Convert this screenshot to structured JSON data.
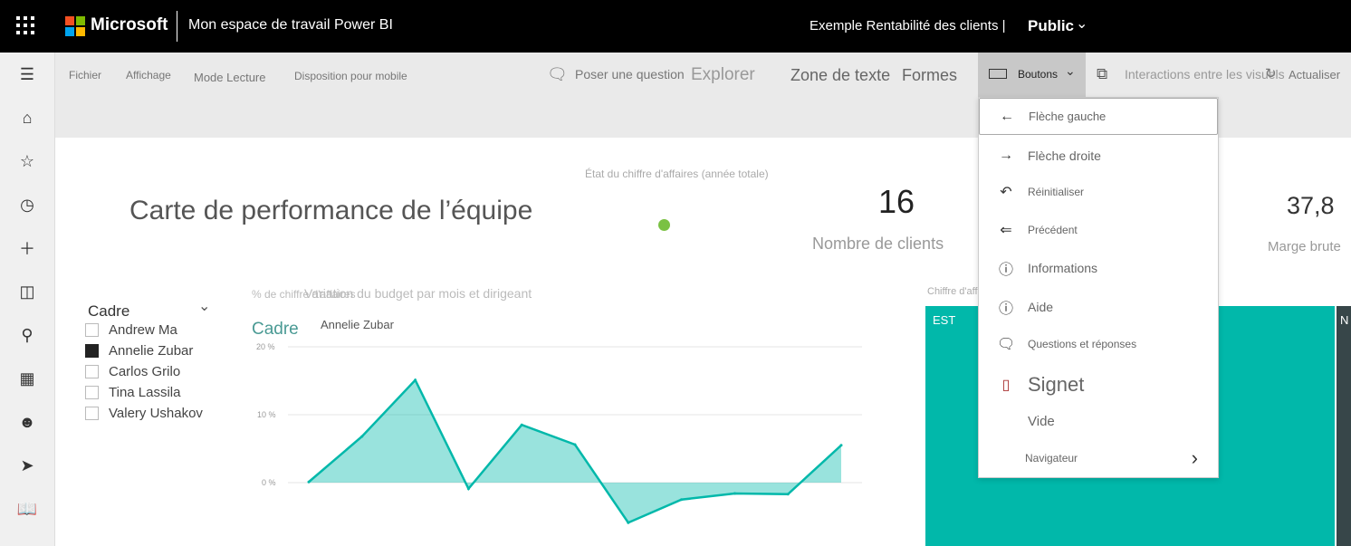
{
  "topbar": {
    "brand": "Microsoft",
    "workspace": "Mon espace de travail Power BI",
    "report": "Exemple Rentabilité des clients |",
    "visibility": "Public"
  },
  "toolbar": {
    "file": "Fichier",
    "view": "Affichage",
    "reading": "Mode Lecture",
    "mobile": "Disposition pour mobile",
    "ask": "Poser une question",
    "explore": "Explorer",
    "textbox": "Zone de texte",
    "shapes": "Formes",
    "buttons": "Boutons",
    "interactions": "Interactions entre les visuels",
    "refresh": "Actualiser"
  },
  "menu": {
    "items": [
      {
        "label": "Flèche gauche",
        "icon": "arrow-left-icon"
      },
      {
        "label": "Flèche droite",
        "icon": "arrow-right-icon"
      },
      {
        "label": "Réinitialiser",
        "icon": "reset-icon"
      },
      {
        "label": "Précédent",
        "icon": "back-icon"
      },
      {
        "label": "Informations",
        "icon": "info-icon"
      },
      {
        "label": "Aide",
        "icon": "help-icon"
      },
      {
        "label": "Questions et réponses",
        "icon": "qna-icon"
      },
      {
        "label": "Signet",
        "icon": "bookmark-icon"
      },
      {
        "label": "Vide"
      },
      {
        "label": "Navigateur",
        "icon": "chevron-right-icon"
      }
    ]
  },
  "report": {
    "title": "Carte de performance de l’équipe",
    "status_title": "État du chiffre d'affaires (année totale)",
    "status_color": "#7ac143",
    "clients_value": "16",
    "clients_label": "Nombre de clients",
    "margin_value": "37,8",
    "margin_label": "Marge brute",
    "treemap_title": "Chiffre d'affaires total",
    "treemap_est": "EST",
    "treemap_n": "N"
  },
  "slicer": {
    "title": "Cadre",
    "items": [
      {
        "label": "Andrew Ma",
        "checked": false
      },
      {
        "label": "Annelie Zubar",
        "checked": true
      },
      {
        "label": "Carlos Grilo",
        "checked": false
      },
      {
        "label": "Tina Lassila",
        "checked": false
      },
      {
        "label": "Valery Ushakov",
        "checked": false
      }
    ]
  },
  "colors": {
    "accent": "#01b8aa",
    "dark": "#374649"
  },
  "chart_data": {
    "type": "area",
    "title": "Variation du budget par mois et dirigeant",
    "title_overlap": "% de chiffre d'affaires",
    "legend_title": "Cadre",
    "legend_entry": "Annelie Zubar",
    "y_ticks": [
      "20 %",
      "10 %",
      "0 %"
    ],
    "ylim": [
      -8,
      20
    ],
    "grid": true,
    "values": [
      0.1,
      6.8,
      15.1,
      -0.9,
      8.5,
      5.6,
      -5.9,
      -2.5,
      -1.6,
      -1.7,
      5.5
    ]
  }
}
